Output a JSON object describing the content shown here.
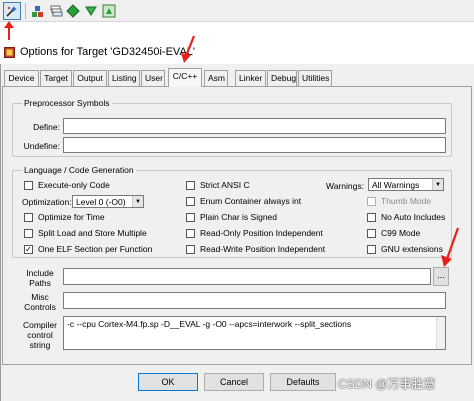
{
  "toolbar": {
    "icons": [
      "wand-settings-icon",
      "stack-icon",
      "layers-icon",
      "green-diamond-icon",
      "green-arrow-icon",
      "multi-project-icon"
    ]
  },
  "dialog": {
    "title": "Options for Target 'GD32450i-EVAL'"
  },
  "tabs": [
    "Device",
    "Target",
    "Output",
    "Listing",
    "User",
    "C/C++",
    "Asm",
    "Linker",
    "Debug",
    "Utilities"
  ],
  "active_tab": "C/C++",
  "preprocessor": {
    "legend": "Preprocessor Symbols",
    "define_label": "Define:",
    "define_value": "",
    "undefine_label": "Undefine:",
    "undefine_value": ""
  },
  "language": {
    "legend": "Language / Code Generation",
    "execute_only": {
      "label": "Execute-only Code",
      "checked": false
    },
    "optimization_label": "Optimization:",
    "optimization_value": "Level 0 (-O0)",
    "optimize_for_time": {
      "label": "Optimize for Time",
      "checked": false
    },
    "split_load_store": {
      "label": "Split Load and Store Multiple",
      "checked": false
    },
    "one_elf": {
      "label": "One ELF Section per Function",
      "checked": true
    },
    "strict_ansi": {
      "label": "Strict ANSI C",
      "checked": false
    },
    "enum_container": {
      "label": "Enum Container always int",
      "checked": false
    },
    "plain_char": {
      "label": "Plain Char is Signed",
      "checked": false
    },
    "ro_pos": {
      "label": "Read-Only Position Independent",
      "checked": false
    },
    "rw_pos": {
      "label": "Read-Write Position Independent",
      "checked": false
    },
    "warnings_label": "Warnings:",
    "warnings_value": "All Warnings",
    "thumb_mode": {
      "label": "Thumb Mode",
      "checked": false
    },
    "no_auto_includes": {
      "label": "No Auto Includes",
      "checked": false
    },
    "c99_mode": {
      "label": "C99 Mode",
      "checked": false
    },
    "gnu_extensions": {
      "label": "GNU extensions",
      "checked": false
    }
  },
  "include_paths": {
    "label": "Include Paths",
    "value": "",
    "browse": "..."
  },
  "misc_controls": {
    "label": "Misc Controls",
    "value": ""
  },
  "compiler_control": {
    "label": "Compiler control string",
    "value": "-c --cpu Cortex-M4.fp.sp -D__EVAL -g -O0 --apcs=interwork --split_sections"
  },
  "buttons": {
    "ok": "OK",
    "cancel": "Cancel",
    "defaults": "Defaults"
  },
  "watermark": "CSDN @万事胜意",
  "colors": {
    "annotation_arrow": "#e8201a",
    "active_tab_bg": "#f7f7f7",
    "dialog_bg": "#f0f0f0"
  }
}
